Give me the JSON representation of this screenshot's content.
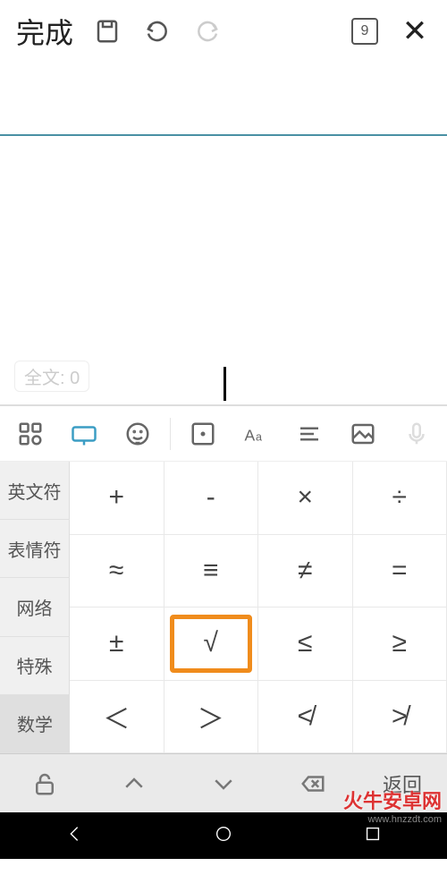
{
  "topbar": {
    "done_label": "完成",
    "page_number": "9",
    "close_glyph": "✕"
  },
  "editor": {
    "counter_prefix": "全文: ",
    "counter_value": "0"
  },
  "tabs": {
    "english": "英文符",
    "emoji": "表情符",
    "network": "网络",
    "special": "特殊",
    "math": "数学"
  },
  "keys": [
    "+",
    "-",
    "×",
    "÷",
    "≈",
    "≡",
    "≠",
    "=",
    "±",
    "√",
    "≤",
    "≥",
    "＜",
    "＞",
    "≮",
    "≯"
  ],
  "highlighted_index": 9,
  "bottom": {
    "return_label": "返回"
  },
  "watermark": {
    "line1": "火牛安卓网",
    "line2": "www.hnzzdt.com"
  }
}
